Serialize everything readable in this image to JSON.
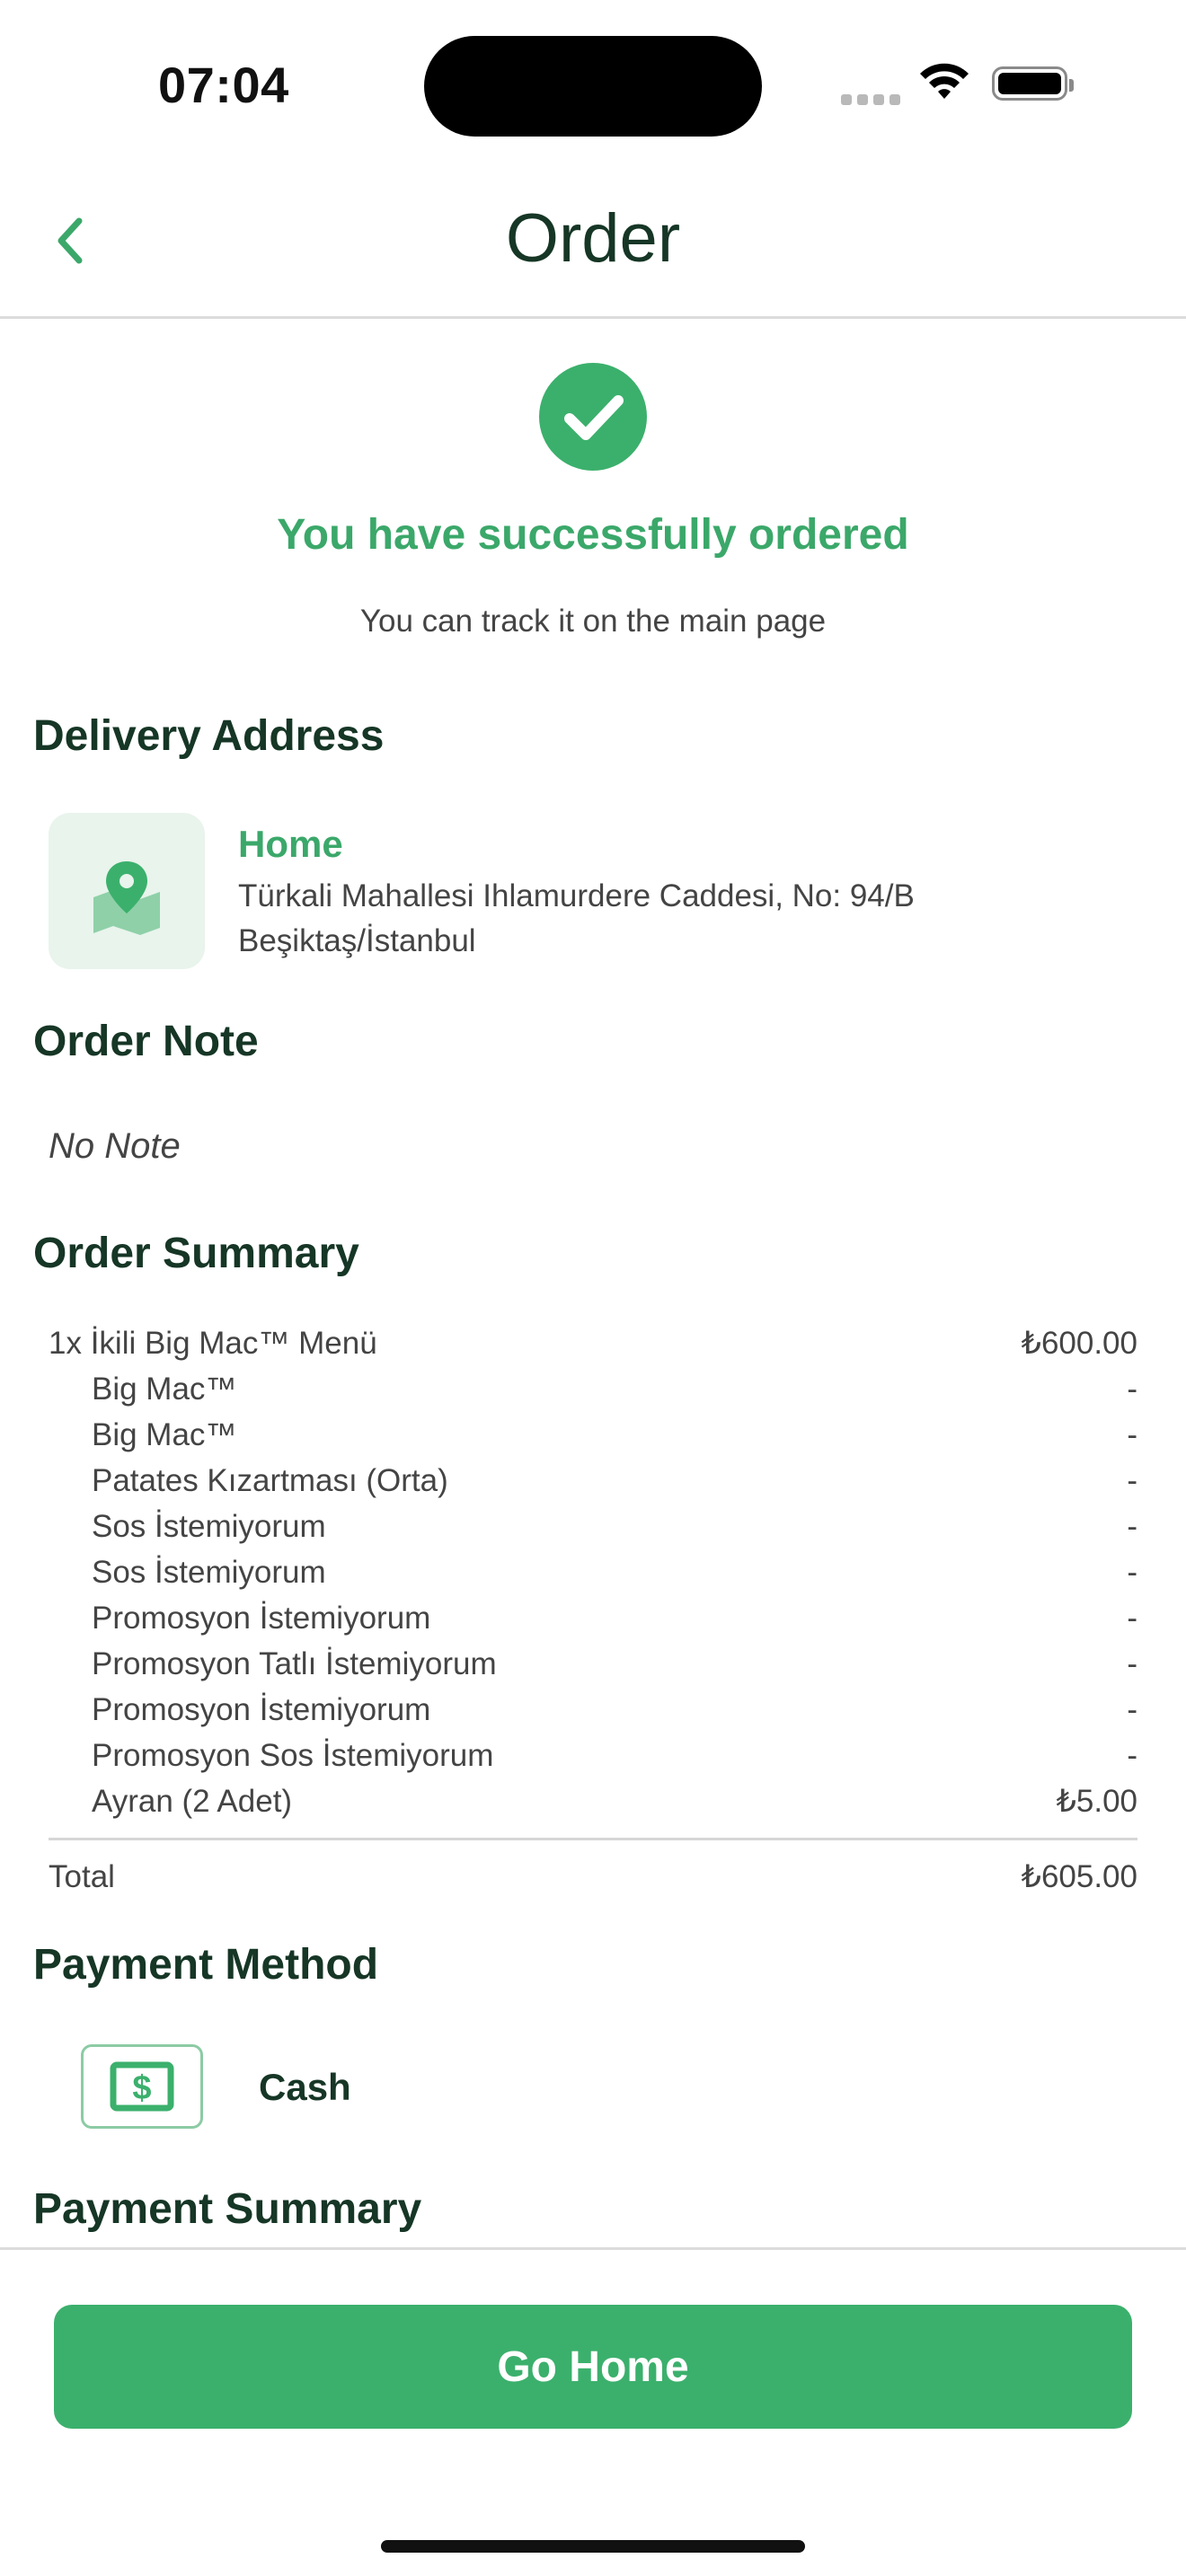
{
  "status_bar": {
    "time": "07:04"
  },
  "header": {
    "title": "Order"
  },
  "success": {
    "title": "You have successfully ordered",
    "subtitle": "You can track it on the main page"
  },
  "delivery": {
    "section_title": "Delivery Address",
    "name": "Home",
    "line1": "Türkali Mahallesi Ihlamurdere Caddesi, No: 94/B",
    "line2": "Beşiktaş/İstanbul"
  },
  "note": {
    "section_title": "Order Note",
    "text": "No Note"
  },
  "summary": {
    "section_title": "Order Summary",
    "items": [
      {
        "name": "1x İkili Big Mac™ Menü",
        "price": "₺600.00"
      },
      {
        "name": "Big Mac™",
        "price": "-"
      },
      {
        "name": "Big Mac™",
        "price": "-"
      },
      {
        "name": "Patates Kızartması (Orta)",
        "price": "-"
      },
      {
        "name": "Sos İstemiyorum",
        "price": "-"
      },
      {
        "name": "Sos İstemiyorum",
        "price": "-"
      },
      {
        "name": "Promosyon İstemiyorum",
        "price": "-"
      },
      {
        "name": "Promosyon Tatlı İstemiyorum",
        "price": "-"
      },
      {
        "name": "Promosyon İstemiyorum",
        "price": "-"
      },
      {
        "name": "Promosyon Sos İstemiyorum",
        "price": "-"
      },
      {
        "name": "Ayran (2 Adet)",
        "price": "₺5.00"
      }
    ],
    "total_label": "Total",
    "total_value": "₺605.00"
  },
  "payment": {
    "section_title": "Payment Method",
    "method": "Cash",
    "icon": "cash-icon"
  },
  "payment_summary": {
    "section_title": "Payment Summary"
  },
  "footer": {
    "button_label": "Go Home"
  },
  "colors": {
    "accent": "#3bb06c",
    "text_dark": "#163626"
  }
}
